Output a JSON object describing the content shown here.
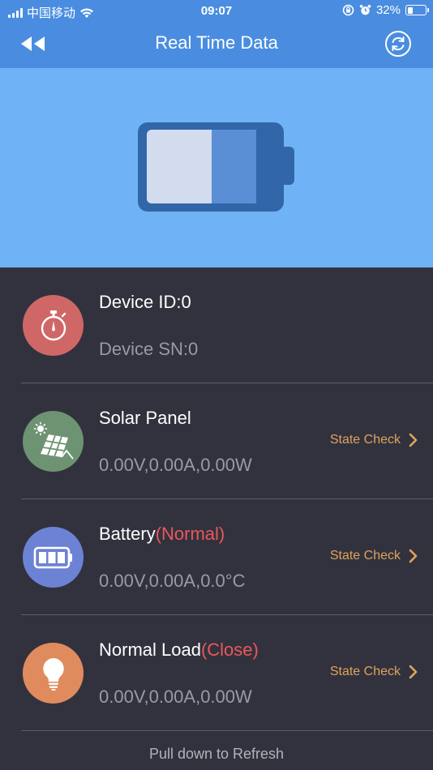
{
  "status_bar": {
    "carrier": "中国移动",
    "time": "09:07",
    "battery_percent": "32%",
    "battery_level": 0.32
  },
  "nav": {
    "title": "Real Time Data",
    "back_icon": "double-chevron-left-icon",
    "refresh_icon": "refresh-icon"
  },
  "hero": {
    "battery_icon": "battery-icon",
    "charge_level": 0.5
  },
  "device": {
    "id_label": "Device ID:0",
    "sn_label": "Device SN:0",
    "icon": "stopwatch-icon",
    "color": "#d06767"
  },
  "solar": {
    "title": "Solar Panel",
    "reading": "0.00V,0.00A,0.00W",
    "action": "State Check",
    "icon": "solar-panel-icon",
    "color": "#6d9373"
  },
  "battery": {
    "title": "Battery",
    "status": "(Normal)",
    "reading": "0.00V,0.00A,0.0°C",
    "action": "State Check",
    "icon": "battery-icon",
    "color": "#6c82d4"
  },
  "load": {
    "title": "Normal Load",
    "status": "(Close)",
    "reading": "0.00V,0.00A,0.00W",
    "action": "State Check",
    "icon": "lightbulb-icon",
    "color": "#e08b5e"
  },
  "footer": {
    "hint": "Pull down to Refresh"
  },
  "colors": {
    "nav_bar": "#4a8de0",
    "hero_bg": "#6fb2f5",
    "list_bg": "#32323e",
    "accent_orange": "#e0a25c",
    "status_red": "#e8585a"
  }
}
